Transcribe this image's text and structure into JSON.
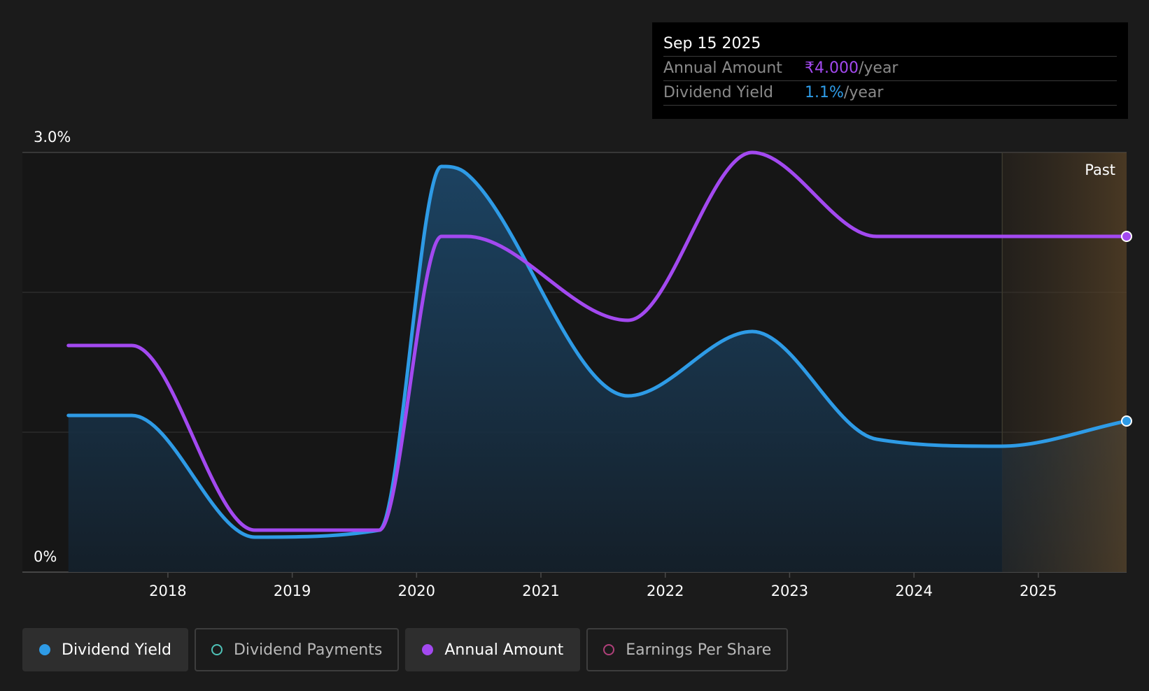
{
  "tooltip": {
    "date": "Sep 15 2025",
    "rows": [
      {
        "label": "Annual Amount",
        "value": "₹4.000",
        "unit": "/year",
        "color": "#a349f0"
      },
      {
        "label": "Dividend Yield",
        "value": "1.1%",
        "unit": "/year",
        "color": "#2e9be6"
      }
    ]
  },
  "legend": [
    {
      "label": "Dividend Yield",
      "color": "#2e9be6",
      "filled": true,
      "active": true
    },
    {
      "label": "Dividend Payments",
      "color": "#4fc3b8",
      "filled": false,
      "active": false
    },
    {
      "label": "Annual Amount",
      "color": "#a349f0",
      "filled": true,
      "active": true
    },
    {
      "label": "Earnings Per Share",
      "color": "#b0407a",
      "filled": false,
      "active": false
    }
  ],
  "chart_data": {
    "type": "line",
    "y_tick_labels": [
      "3.0%",
      "0%"
    ],
    "ylim": [
      0,
      3.0
    ],
    "xlim": [
      2016.83,
      2025.71
    ],
    "x_ticks": [
      "2018",
      "2019",
      "2020",
      "2021",
      "2022",
      "2023",
      "2024",
      "2025"
    ],
    "grid": true,
    "past_label": "Past",
    "past_region_start": 2024.71,
    "series": [
      {
        "name": "Dividend Yield",
        "color": "#2e9be6",
        "fill": true,
        "points": [
          [
            2017.2,
            1.12
          ],
          [
            2017.71,
            1.12
          ],
          [
            2018.7,
            0.25
          ],
          [
            2019.7,
            0.3
          ],
          [
            2020.2,
            2.9
          ],
          [
            2020.4,
            2.85
          ],
          [
            2021.7,
            1.26
          ],
          [
            2022.7,
            1.72
          ],
          [
            2023.7,
            0.95
          ],
          [
            2024.7,
            0.9
          ],
          [
            2025.71,
            1.08
          ]
        ]
      },
      {
        "name": "Annual Amount",
        "color": "#a349f0",
        "fill": false,
        "points": [
          [
            2017.2,
            1.62
          ],
          [
            2017.71,
            1.62
          ],
          [
            2018.7,
            0.3
          ],
          [
            2019.7,
            0.3
          ],
          [
            2020.2,
            2.4
          ],
          [
            2020.4,
            2.4
          ],
          [
            2021.7,
            1.8
          ],
          [
            2022.7,
            3.0
          ],
          [
            2023.7,
            2.4
          ],
          [
            2024.7,
            2.4
          ],
          [
            2025.71,
            2.4
          ]
        ]
      }
    ]
  }
}
